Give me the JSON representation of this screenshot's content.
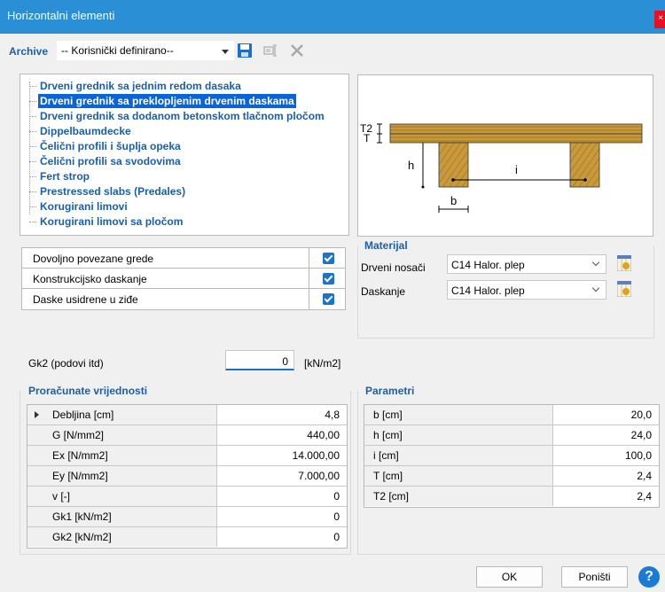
{
  "window": {
    "title": "Horizontalni elementi",
    "close_label": "×"
  },
  "toolbar": {
    "archive_label": "Archive",
    "archive_value": "-- Korisnički definirano--"
  },
  "tree": {
    "items": [
      {
        "label": "Drveni grednik sa jednim redom dasaka",
        "selected": false
      },
      {
        "label": "Drveni grednik sa preklopljenim drvenim daskama",
        "selected": true
      },
      {
        "label": "Drveni grednik sa dodanom betonskom tlačnom pločom",
        "selected": false
      },
      {
        "label": "Dippelbaumdecke",
        "selected": false
      },
      {
        "label": "Čelični profili i šuplja opeka",
        "selected": false
      },
      {
        "label": "Čelični profili sa svodovima",
        "selected": false
      },
      {
        "label": "Fert strop",
        "selected": false
      },
      {
        "label": "Prestressed slabs (Predales)",
        "selected": false
      },
      {
        "label": "Korugirani limovi",
        "selected": false
      },
      {
        "label": "Korugirani limovi sa pločom",
        "selected": false
      }
    ]
  },
  "drawing": {
    "t2": "T2",
    "t": "T",
    "h": "h",
    "i": "i",
    "b": "b"
  },
  "options": [
    {
      "label": "Dovoljno povezane grede",
      "checked": true
    },
    {
      "label": "Konstrukcijsko daskanje",
      "checked": true
    },
    {
      "label": "Daske usidrene u ziđe",
      "checked": true
    }
  ],
  "material": {
    "title": "Materijal",
    "rows": [
      {
        "label": "Drveni nosači",
        "value": "C14 Halor. plep"
      },
      {
        "label": "Daskanje",
        "value": "C14 Halor. plep"
      }
    ]
  },
  "gk2": {
    "label": "Gk2 (podovi itd)",
    "value": "0",
    "unit": "[kN/m2]"
  },
  "computed": {
    "title": "Proračunate vrijednosti",
    "rows": [
      {
        "key": "Debljina [cm]",
        "value": "4,8",
        "current": true
      },
      {
        "key": "G [N/mm2]",
        "value": "440,00"
      },
      {
        "key": "Ex [N/mm2]",
        "value": "14.000,00"
      },
      {
        "key": "Ey [N/mm2]",
        "value": "7.000,00"
      },
      {
        "key": "v  [-]",
        "value": "0"
      },
      {
        "key": "Gk1 [kN/m2]",
        "value": "0"
      },
      {
        "key": "Gk2 [kN/m2]",
        "value": "0"
      }
    ]
  },
  "params": {
    "title": "Parametri",
    "rows": [
      {
        "key": "b [cm]",
        "value": "20,0"
      },
      {
        "key": "h [cm]",
        "value": "24,0"
      },
      {
        "key": "i [cm]",
        "value": "100,0"
      },
      {
        "key": "T [cm]",
        "value": "2,4"
      },
      {
        "key": "T2 [cm]",
        "value": "2,4"
      }
    ]
  },
  "buttons": {
    "ok": "OK",
    "cancel": "Poništi",
    "help": "?"
  },
  "colors": {
    "accent": "#1a5fa8",
    "titlebar": "#2b8fd6",
    "selection": "#0a64d6",
    "wood": "#c89a3c"
  }
}
